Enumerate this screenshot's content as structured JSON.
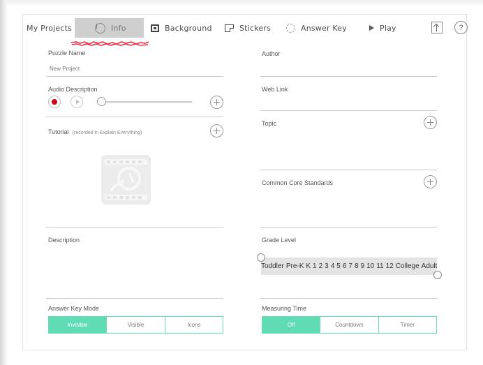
{
  "tabs": {
    "my_projects": "My Projects",
    "info": "Info",
    "info_icon": "i",
    "background": "Background",
    "stickers": "Stickers",
    "answer_key": "Answer Key",
    "play": "Play",
    "help": "?"
  },
  "left": {
    "puzzle_name_label": "Puzzle Name",
    "puzzle_name_value": "New Project",
    "audio_label": "Audio Description",
    "tutorial_label": "Tutorial",
    "tutorial_note": "(recorded in Explain Everything)",
    "description_label": "Description",
    "answer_key_mode_label": "Answer Key Mode",
    "answer_key_mode_options": [
      "Invisible",
      "Visible",
      "Icons"
    ],
    "answer_key_mode_selected": "Invisible"
  },
  "right": {
    "author_label": "Author",
    "web_link_label": "Web Link",
    "topic_label": "Topic",
    "common_core_label": "Common Core Standards",
    "grade_level_label": "Grade Level",
    "grade_levels": [
      "Toddler",
      "Pre-K",
      "K",
      "1",
      "2",
      "3",
      "4",
      "5",
      "6",
      "7",
      "8",
      "9",
      "10",
      "11",
      "12",
      "College",
      "Adult"
    ],
    "measuring_time_label": "Measuring Time",
    "measuring_time_options": [
      "Off",
      "Countdown",
      "Timer"
    ],
    "measuring_time_selected": "Off"
  },
  "colors": {
    "accent": "#5fdcb3",
    "record": "#d0021b",
    "active_tab": "#cfcfcf",
    "scribble": "#e8334a"
  }
}
